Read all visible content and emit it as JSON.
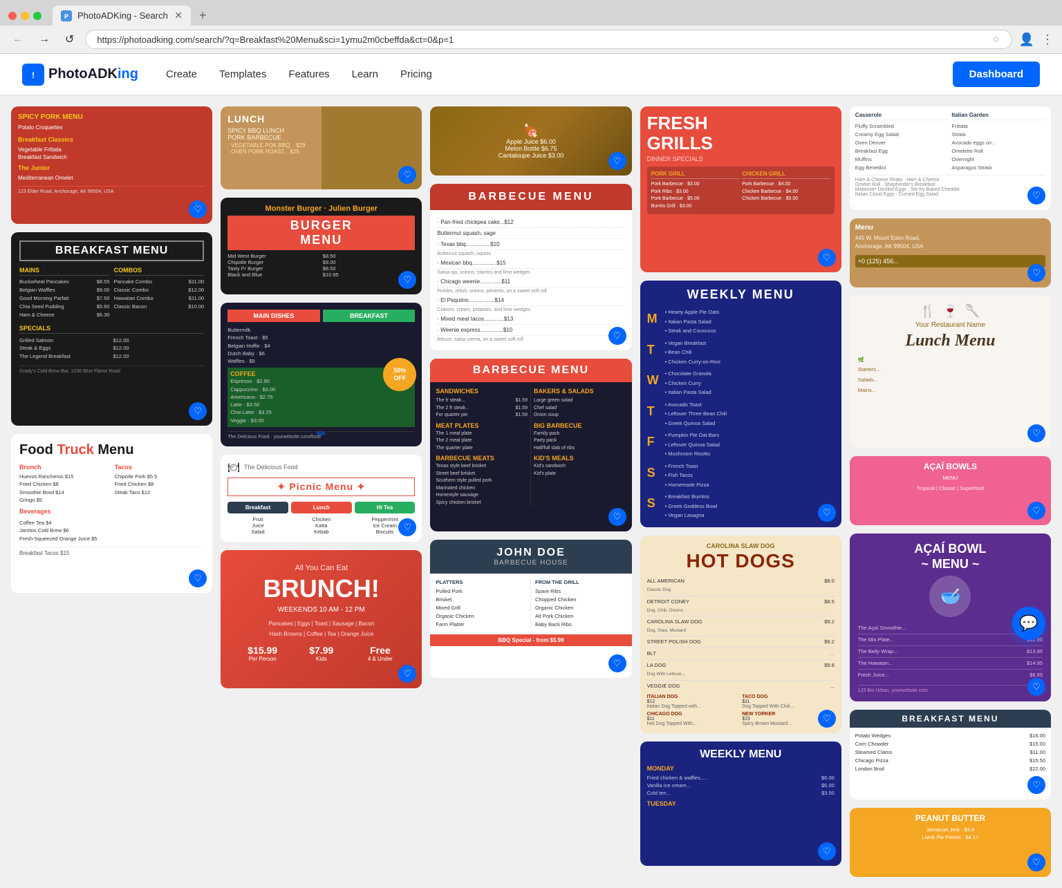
{
  "browser": {
    "tab_label": "PhotoADKing - Search",
    "favicon": "P",
    "url": "https://photoadking.com/search/?q=Breakfast%20Menu&sci=1ymu2m0cbeffda&ct=0&p=1",
    "nav_back": "←",
    "nav_forward": "→",
    "nav_refresh": "↺"
  },
  "nav": {
    "logo_icon": "!",
    "logo_name": "PhotoADK",
    "logo_suffix": "ing",
    "links": [
      "Create",
      "Templates",
      "Features",
      "Learn",
      "Pricing"
    ],
    "dashboard_btn": "Dashboard"
  },
  "cards": [
    {
      "id": "potato-menu",
      "title": "Potato Croquettes",
      "type": "breakfast-classics",
      "bg": "#c0392b"
    },
    {
      "id": "spicy-bbq",
      "title": "SPICY BBQ LUNCH",
      "bg": "#c0392b"
    },
    {
      "id": "bbq-menu-white",
      "title": "BARBECUE MENU",
      "bg": "white"
    },
    {
      "id": "fresh-grills",
      "title": "FRESH GRILLS",
      "bg": "#e74c3c"
    },
    {
      "id": "casserole-menu",
      "title": "Casserole Menu",
      "bg": "white"
    },
    {
      "id": "tan-top",
      "title": "Menu",
      "bg": "#c4955a"
    },
    {
      "id": "breakfast-menu-black",
      "title": "BREAKFAST MENU",
      "bg": "#1a1a1a"
    },
    {
      "id": "burger-menu",
      "title": "BURGER MENU",
      "bg": "#1a1a1a"
    },
    {
      "id": "bbq-menu-dark",
      "title": "BARBECUE MENU",
      "bg": "#2c2c2c"
    },
    {
      "id": "weekly-menu-blue",
      "title": "WEEKLY MENU",
      "bg": "#1a237e"
    },
    {
      "id": "italian-garden",
      "title": "Italian Garden",
      "bg": "white"
    },
    {
      "id": "address-card",
      "title": "445 W. Mount Eden Road, Anchorage, AK 99504, USA",
      "bg": "#c4955a"
    },
    {
      "id": "food-truck-menu",
      "title": "Food Truck Menu",
      "bg": "white"
    },
    {
      "id": "picnic-menu",
      "title": "Picnic Menu",
      "bg": "white"
    },
    {
      "id": "barbecue-menu-v2",
      "title": "BARBECUE MENU",
      "bg": "#1a1a2e"
    },
    {
      "id": "weekly-menu-v2",
      "title": "WEEKLY MENU",
      "bg": "#2c3e50"
    },
    {
      "id": "lunch-menu",
      "title": "Lunch Menu",
      "bg": "#f8f4f0"
    },
    {
      "id": "acai-bowls",
      "title": "AÇAÍ BOWLS",
      "bg": "#7b3fa0"
    },
    {
      "id": "brunch-card",
      "title": "All You Can Eat BRUNCH!",
      "bg": "#e74c3c"
    },
    {
      "id": "john-doe-bbq",
      "title": "JOHN DOE BARBECUE HOUSE",
      "bg": "#2c3e50"
    },
    {
      "id": "weekly-menu-v3",
      "title": "WEEKLY MENU",
      "bg": "#1a237e"
    },
    {
      "id": "hot-dogs",
      "title": "HOT DOGS",
      "bg": "#f5e6c8"
    },
    {
      "id": "acai-bowl-main",
      "title": "AÇAÍ BOWL ~ MENU ~",
      "bg": "#5b2d8e"
    },
    {
      "id": "breakfast-menu-v2",
      "title": "BREAKFAST MENU",
      "bg": "white"
    },
    {
      "id": "weekly-menu-v4",
      "title": "WEEKLY MENU",
      "bg": "#1a237e"
    },
    {
      "id": "peanut-butter",
      "title": "PEANUT BUTTER",
      "bg": "#f5a623"
    }
  ],
  "chat_btn": "💬"
}
